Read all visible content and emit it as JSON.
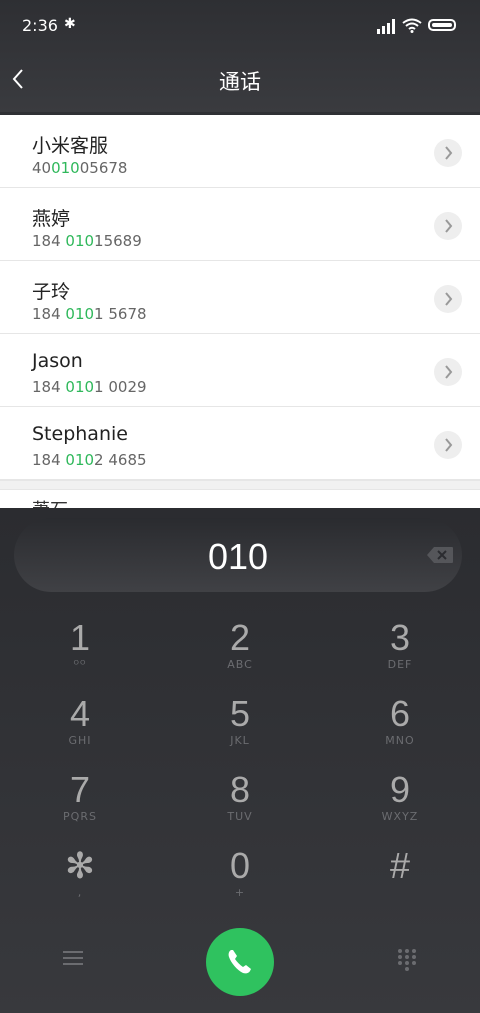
{
  "status": {
    "time": "2:36"
  },
  "header": {
    "title": "通话"
  },
  "contacts": [
    {
      "name": "小米客服",
      "num_pre": "40",
      "num_hl": "010",
      "num_post": "05678"
    },
    {
      "name": "燕婷",
      "num_pre": "184 ",
      "num_hl": "010",
      "num_post": "15689"
    },
    {
      "name": "子玲",
      "num_pre": "184 ",
      "num_hl": "010",
      "num_post": "1 5678"
    },
    {
      "name": "Jason",
      "num_pre": "184 ",
      "num_hl": "010",
      "num_post": "1 0029"
    },
    {
      "name": "Stephanie",
      "num_pre": "184 ",
      "num_hl": "010",
      "num_post": "2 4685"
    }
  ],
  "partial_contact": {
    "name": "萧石"
  },
  "dialer": {
    "input": "010",
    "keys": [
      {
        "d": "1",
        "l": "ᴼᴼ"
      },
      {
        "d": "2",
        "l": "ABC"
      },
      {
        "d": "3",
        "l": "DEF"
      },
      {
        "d": "4",
        "l": "GHI"
      },
      {
        "d": "5",
        "l": "JKL"
      },
      {
        "d": "6",
        "l": "MNO"
      },
      {
        "d": "7",
        "l": "PQRS"
      },
      {
        "d": "8",
        "l": "TUV"
      },
      {
        "d": "9",
        "l": "WXYZ"
      },
      {
        "d": "✻",
        "l": ","
      },
      {
        "d": "0",
        "l": "+"
      },
      {
        "d": "#",
        "l": ""
      }
    ]
  },
  "colors": {
    "accent": "#2fb85b",
    "call": "#2fc25f"
  }
}
